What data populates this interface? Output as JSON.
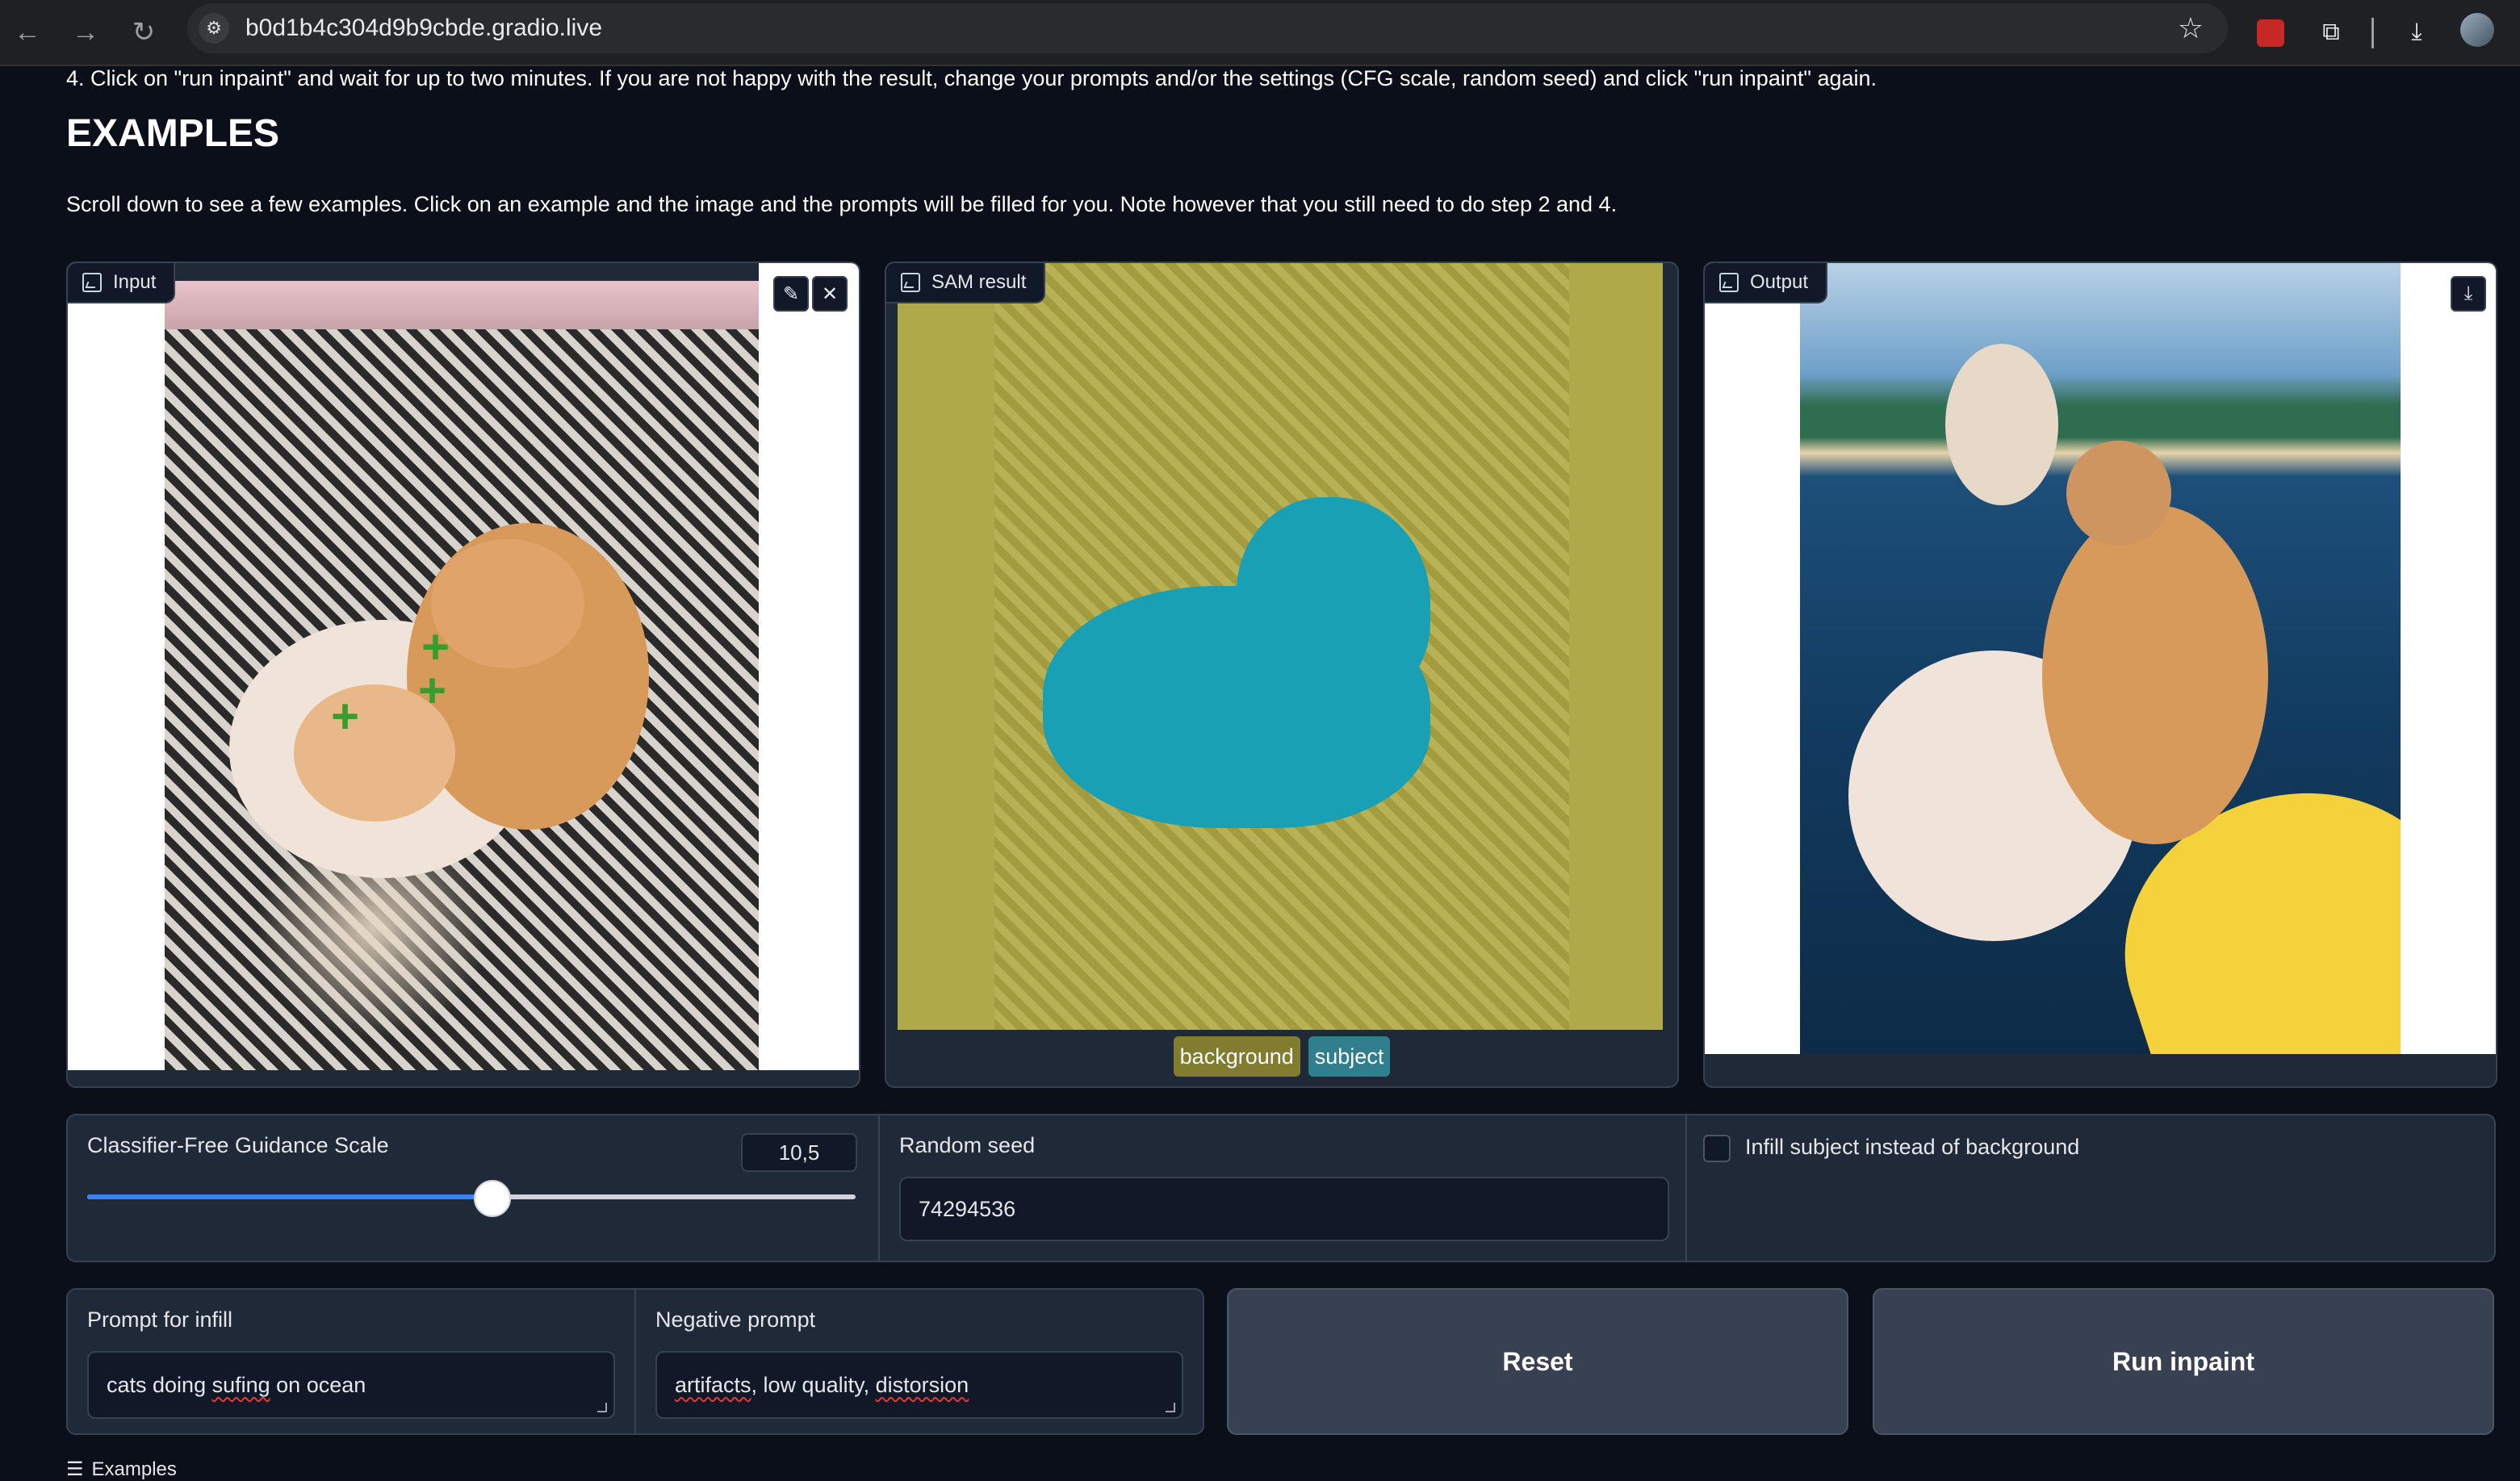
{
  "browser": {
    "url": "b0d1b4c304d9b9cbde.gradio.live"
  },
  "content": {
    "step4": "4. Click on \"run inpaint\" and wait for up to two minutes. If you are not happy with the result, change your prompts and/or the settings (CFG scale, random seed) and click \"run inpaint\" again.",
    "heading": "EXAMPLES",
    "scroll_note": "Scroll down to see a few examples. Click on an example and the image and the prompts will be filled for you. Note however that you still need to do step 2 and 4."
  },
  "panels": {
    "input_label": "Input",
    "sam_label": "SAM result",
    "output_label": "Output",
    "sam_chips": [
      "background",
      "subject"
    ]
  },
  "controls": {
    "cfg_label": "Classifier-Free Guidance Scale",
    "cfg_value": "10,5",
    "cfg_fraction": 0.525,
    "seed_label": "Random seed",
    "seed_value": "74294536",
    "infill_subject_label": "Infill subject instead of background",
    "infill_subject_checked": false
  },
  "prompts": {
    "infill_label": "Prompt for infill",
    "infill_value": "cats doing sufing on ocean",
    "negative_label": "Negative prompt",
    "negative_value": "artifacts, low quality, distorsion"
  },
  "buttons": {
    "reset": "Reset",
    "run": "Run inpaint"
  },
  "footer": {
    "examples_label": "Examples"
  },
  "colors": {
    "page_bg": "#0b0f19",
    "block_bg": "#1f2937",
    "slider_accent": "#3b82f6",
    "chip_background": "#827d2e",
    "chip_subject": "#2f7f8f"
  }
}
